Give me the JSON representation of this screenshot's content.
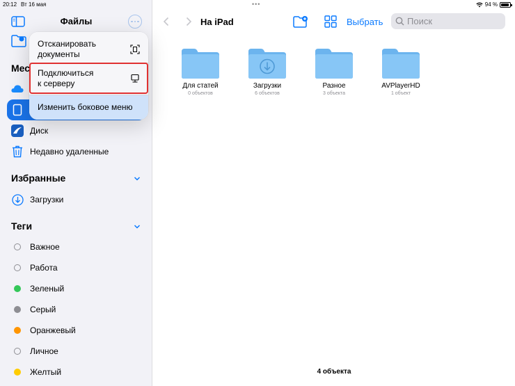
{
  "status_bar": {
    "time": "20:12",
    "date": "Вт 16 мая",
    "battery": "94 %",
    "battery_level": 0.94
  },
  "sidebar": {
    "title": "Файлы",
    "partial_section": "Мес",
    "locations": [
      {
        "label": "iPad",
        "icon": "ipad-icon",
        "selected": true
      },
      {
        "label": "Диск",
        "icon": "drive-icon"
      },
      {
        "label": "Недавно удаленные",
        "icon": "trash-icon"
      }
    ],
    "favorites": {
      "title": "Избранные",
      "items": [
        {
          "label": "Загрузки",
          "icon": "download-icon"
        }
      ]
    },
    "tags": {
      "title": "Теги",
      "items": [
        {
          "label": "Важное",
          "color": ""
        },
        {
          "label": "Работа",
          "color": ""
        },
        {
          "label": "Зеленый",
          "color": "#34c759"
        },
        {
          "label": "Серый",
          "color": "#8e8e93"
        },
        {
          "label": "Оранжевый",
          "color": "#ff9500"
        },
        {
          "label": "Личное",
          "color": ""
        },
        {
          "label": "Желтый",
          "color": "#ffcc00"
        }
      ]
    }
  },
  "menu": {
    "items": [
      {
        "label": "Отсканировать\nдокументы",
        "icon": "scan-icon"
      },
      {
        "label": "Подключиться\nк серверу",
        "icon": "server-icon",
        "highlighted": true
      },
      {
        "label": "Изменить боковое меню",
        "icon": ""
      }
    ]
  },
  "toolbar": {
    "location_title": "На iPad",
    "select_label": "Выбрать",
    "search_placeholder": "Поиск"
  },
  "folders": [
    {
      "name": "Для статей",
      "count": "0 объектов",
      "has_download_badge": false
    },
    {
      "name": "Загрузки",
      "count": "6 объектов",
      "has_download_badge": true
    },
    {
      "name": "Разное",
      "count": "3 объекта",
      "has_download_badge": false
    },
    {
      "name": "AVPlayerHD",
      "count": "1 объект",
      "has_download_badge": false
    }
  ],
  "footer": {
    "item_count": "4 объекта"
  },
  "colors": {
    "accent": "#0a7aff",
    "selected_bg": "#1a73e8",
    "folder": "#74b9f0",
    "highlight_border": "#e03131"
  }
}
